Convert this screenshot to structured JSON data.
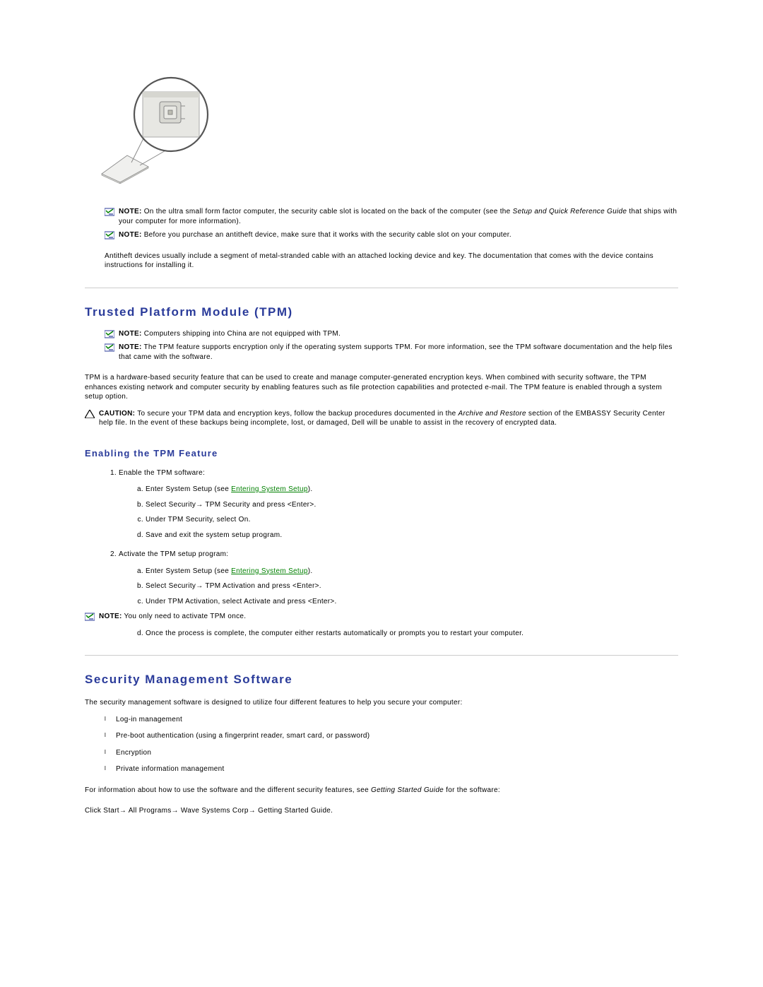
{
  "notes": {
    "usff": {
      "label": "NOTE:",
      "text_before": " On the ultra small form factor computer, the security cable slot is located on the back of the computer (see the ",
      "italic": "Setup and Quick Reference Guide",
      "text_after": " that ships with your computer for more information)."
    },
    "antitheft_device": {
      "label": "NOTE:",
      "text": " Before you purchase an antitheft device, make sure that it works with the security cable slot on your computer."
    },
    "china": {
      "label": "NOTE:",
      "text": " Computers shipping into China are not equipped with TPM."
    },
    "encryption_support": {
      "label": "NOTE:",
      "text": " The TPM feature supports encryption only if the operating system supports TPM. For more information, see the TPM software documentation and the help files that came with the software."
    },
    "activate_once": {
      "label": "NOTE:",
      "text": " You only need to activate TPM once."
    }
  },
  "caution": {
    "label": "CAUTION:",
    "text_before": " To secure your TPM data and encryption keys, follow the backup procedures documented in the ",
    "italic": "Archive and Restore",
    "text_after": " section of the EMBASSY Security Center help file. In the event of these backups being incomplete, lost, or damaged, Dell will be unable to assist in the recovery of encrypted data."
  },
  "paras": {
    "antitheft": "Antitheft devices usually include a segment of metal-stranded cable with an attached locking device and key. The documentation that comes with the device contains instructions for installing it.",
    "tpm_desc": "TPM is a hardware-based security feature that can be used to create and manage computer-generated encryption keys. When combined with security software, the TPM enhances existing network and computer security by enabling features such as file protection capabilities and protected e-mail. The TPM feature is enabled through a system setup option.",
    "sms_intro": "The security management software is designed to utilize four different features to help you secure your computer:",
    "sms_info_before": "For information about how to use the software and the different security features, see ",
    "sms_info_italic": "Getting Started Guide",
    "sms_info_after": " for the software:",
    "sms_path": "Click Start→ All Programs→ Wave Systems Corp→ Getting Started Guide."
  },
  "headings": {
    "tpm": "Trusted Platform Module (TPM)",
    "enabling": "Enabling the TPM Feature",
    "sms": "Security Management Software"
  },
  "steps": {
    "s1_intro": "Enable the TPM software:",
    "s1a_before": "Enter System Setup (see ",
    "s1a_link": "Entering System Setup",
    "s1a_after": ").",
    "s1b": "Select Security→ TPM Security and press <Enter>.",
    "s1c": "Under TPM Security, select On.",
    "s1d": "Save and exit the system setup program.",
    "s2_intro": "Activate the TPM setup program:",
    "s2a_before": "Enter System Setup (see ",
    "s2a_link": "Entering System Setup",
    "s2a_after": ").",
    "s2b": "Select Security→ TPM Activation and press <Enter>.",
    "s2c": "Under TPM Activation, select Activate and press <Enter>.",
    "s2d": "Once the process is complete, the computer either restarts automatically or prompts you to restart your computer."
  },
  "features": {
    "f1": "Log-in management",
    "f2": "Pre-boot authentication (using a fingerprint reader, smart card, or password)",
    "f3": "Encryption",
    "f4": "Private information management"
  }
}
